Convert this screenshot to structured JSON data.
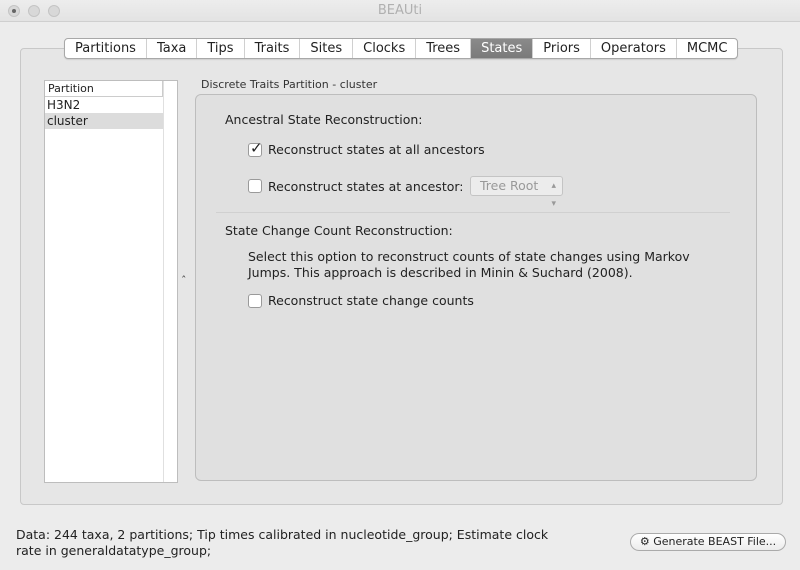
{
  "window": {
    "title": "BEAUti"
  },
  "tabs": [
    {
      "label": "Partitions"
    },
    {
      "label": "Taxa"
    },
    {
      "label": "Tips"
    },
    {
      "label": "Traits"
    },
    {
      "label": "Sites"
    },
    {
      "label": "Clocks"
    },
    {
      "label": "Trees"
    },
    {
      "label": "States",
      "active": true
    },
    {
      "label": "Priors"
    },
    {
      "label": "Operators"
    },
    {
      "label": "MCMC"
    }
  ],
  "partition_list": {
    "header": "Partition",
    "items": [
      {
        "label": "H3N2"
      },
      {
        "label": "cluster",
        "selected": true
      }
    ]
  },
  "splitter_glyph": "ˆ",
  "content": {
    "partition_label": "Discrete Traits Partition - cluster",
    "ancestral_heading": "Ancestral State Reconstruction:",
    "all_ancestors": {
      "label": "Reconstruct states at all ancestors",
      "checked": true
    },
    "at_ancestor": {
      "label": "Reconstruct states at ancestor:",
      "checked": false,
      "select_value": "Tree Root"
    },
    "state_change_heading": "State Change Count Reconstruction:",
    "description_line1": "Select this option to reconstruct counts of state changes using Markov",
    "description_line2": "Jumps. This approach is described in Minin & Suchard (2008).",
    "state_change": {
      "label": "Reconstruct state change counts",
      "checked": false
    }
  },
  "status": {
    "line1": "Data: 244 taxa, 2 partitions; Tip times calibrated in nucleotide_group; Estimate clock",
    "line2": "rate in generaldatatype_group;"
  },
  "generate_button": {
    "label": "Generate BEAST File...",
    "icon": "gear-icon"
  }
}
